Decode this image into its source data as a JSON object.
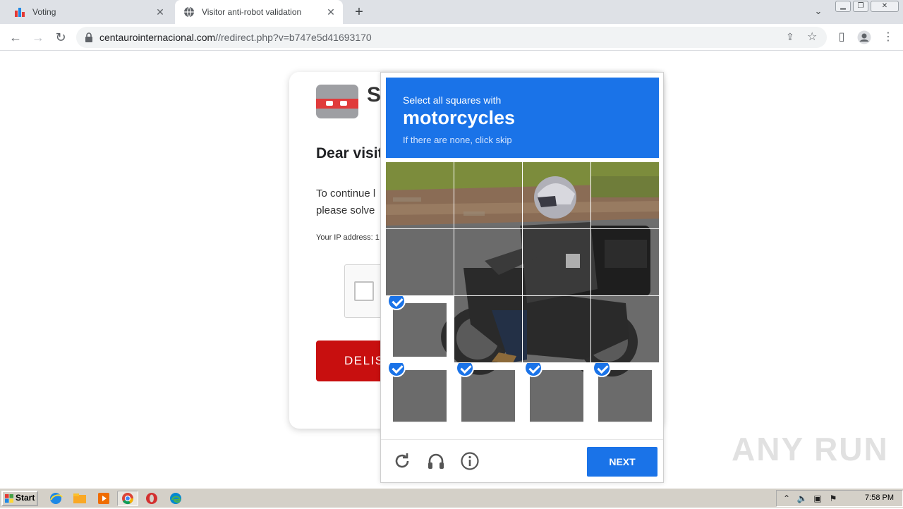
{
  "browser": {
    "tabs": [
      {
        "title": "Voting",
        "active": false
      },
      {
        "title": "Visitor anti-robot validation",
        "active": true
      }
    ],
    "url_domain": "centaurointernacional.com",
    "url_path": "//redirect.php?v=b747e5d41693170"
  },
  "page": {
    "logo_letter": "S",
    "heading": "Dear visit",
    "line1": "To continue l",
    "line2": "please solve",
    "ip_label": "Your IP address: 1",
    "button_label": "DELIS"
  },
  "captcha": {
    "instruction": "Select all squares with",
    "target": "motorcycles",
    "hint": "If there are none, click skip",
    "next_label": "NEXT",
    "selected_tiles": [
      8,
      12,
      13,
      14,
      15
    ],
    "accent": "#1a73e8"
  },
  "taskbar": {
    "start_label": "Start",
    "clock": "7:58 PM"
  },
  "watermark": "ANY RUN"
}
